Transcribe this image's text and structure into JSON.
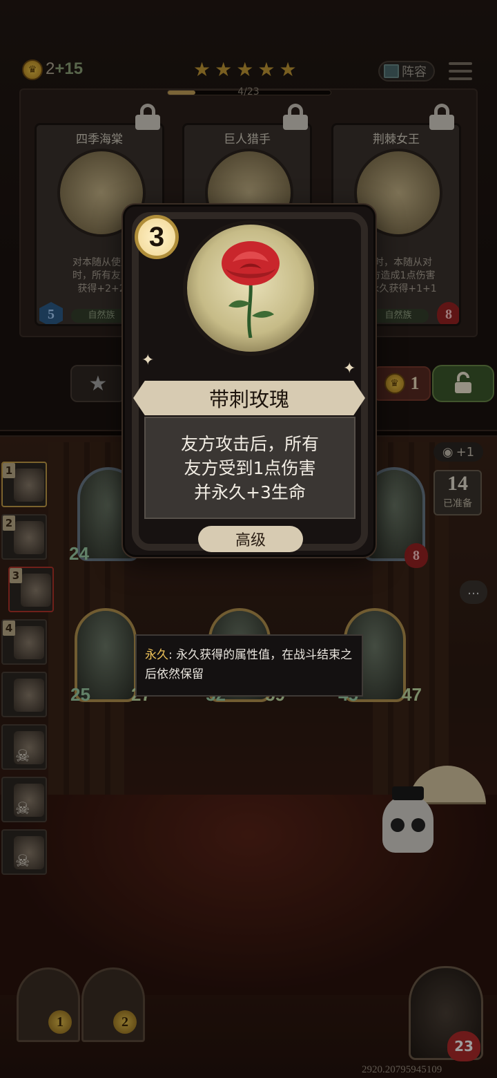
{
  "top_bar": {
    "gold": "2",
    "income": "+15",
    "star_rating": 5,
    "xp_progress": "4/23",
    "xp_fraction": 0.17,
    "lineup_label": "阵容"
  },
  "shop": {
    "cards": [
      {
        "name": "四季海棠",
        "desc": "对本随从使用\n时，所有友方\n获得+2+2",
        "attack": "5",
        "tribe": "自然族",
        "locked": true
      },
      {
        "name": "巨人猎手",
        "desc": "",
        "attack": "",
        "tribe": "",
        "locked": true
      },
      {
        "name": "荆棘女王",
        "desc": "击时，本随从对\n友方造成1点伤害\n其永久获得+1+1",
        "health": "8",
        "tribe": "自然族",
        "locked": true
      }
    ],
    "buy_cost": "1"
  },
  "popup_card": {
    "tier": "3",
    "name": "带刺玫瑰",
    "desc_line1": "友方攻击后，所有",
    "desc_line2": "友方受到1点伤害",
    "desc_line3": "并永久+3生命",
    "rarity": "高级"
  },
  "tooltip": {
    "keyword": "永久",
    "text": ": 永久获得的属性值，在战斗结束之后依然保留"
  },
  "board": {
    "top_row": [
      {
        "attack": "24"
      },
      {},
      {
        "health": "8"
      }
    ],
    "bottom_row": [
      {
        "attack": "25",
        "health": "27"
      },
      {
        "attack": "52",
        "health": "59"
      },
      {
        "attack": "45",
        "health": "47"
      }
    ]
  },
  "roster": [
    "1",
    "2",
    "3",
    "4"
  ],
  "ready": {
    "count": "14",
    "label": "已准备",
    "eye_bonus": "+1"
  },
  "gates": [
    "1",
    "2"
  ],
  "hero": {
    "health": "23"
  },
  "coordinates_text": "2920.20795945109",
  "colors": {
    "gold": "#c39a36",
    "hp_red": "#9a2222",
    "attack_blue": "#2c5c8a",
    "keyword": "#f0c45a"
  }
}
